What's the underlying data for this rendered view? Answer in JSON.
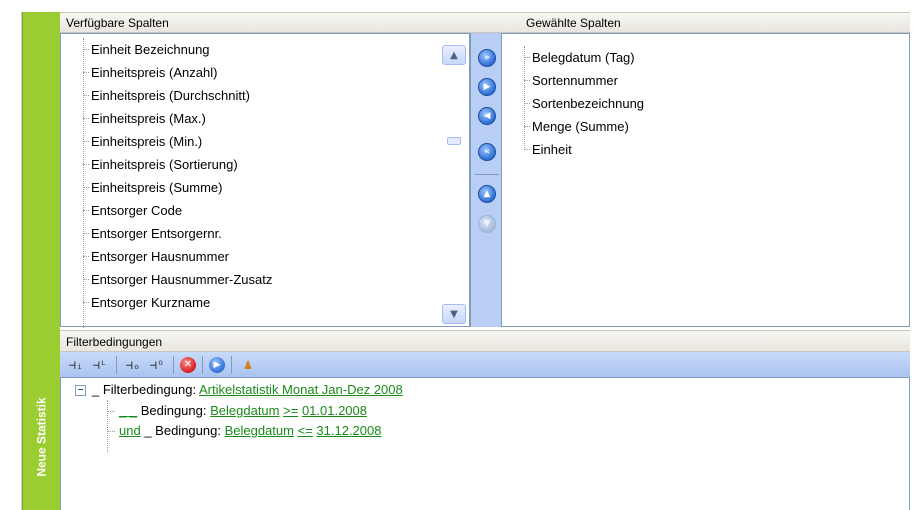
{
  "sidebar": {
    "label": "Neue Statistik"
  },
  "available": {
    "header": "Verfügbare Spalten",
    "items": [
      "Einheit Bezeichnung",
      "Einheitspreis (Anzahl)",
      "Einheitspreis (Durchschnitt)",
      "Einheitspreis (Max.)",
      "Einheitspreis (Min.)",
      "Einheitspreis (Sortierung)",
      "Einheitspreis (Summe)",
      "Entsorger Code",
      "Entsorger Entsorgernr.",
      "Entsorger Hausnummer",
      "Entsorger Hausnummer-Zusatz",
      "Entsorger Kurzname"
    ]
  },
  "chosen": {
    "header": "Gewählte Spalten",
    "items": [
      "Belegdatum (Tag)",
      "Sortennummer",
      "Sortenbezeichnung",
      "Menge (Summe)",
      "Einheit"
    ]
  },
  "filter": {
    "header": "Filterbedingungen",
    "root_prefix": "_ Filterbedingung:",
    "root_link": "Artikelstatistik Monat Jan-Dez 2008",
    "conditions": [
      {
        "prefix": "_ _",
        "label": "Bedingung:",
        "field": "Belegdatum",
        "op": ">=",
        "value": "01.01.2008"
      },
      {
        "prefix": "und",
        "label": "_ Bedingung:",
        "field": "Belegdatum",
        "op": "<=",
        "value": "31.12.2008"
      }
    ]
  },
  "colors": {
    "sidebar_green": "#9acd32",
    "link_green": "#1a8a1a",
    "mover_blue": "#b8cef5"
  }
}
